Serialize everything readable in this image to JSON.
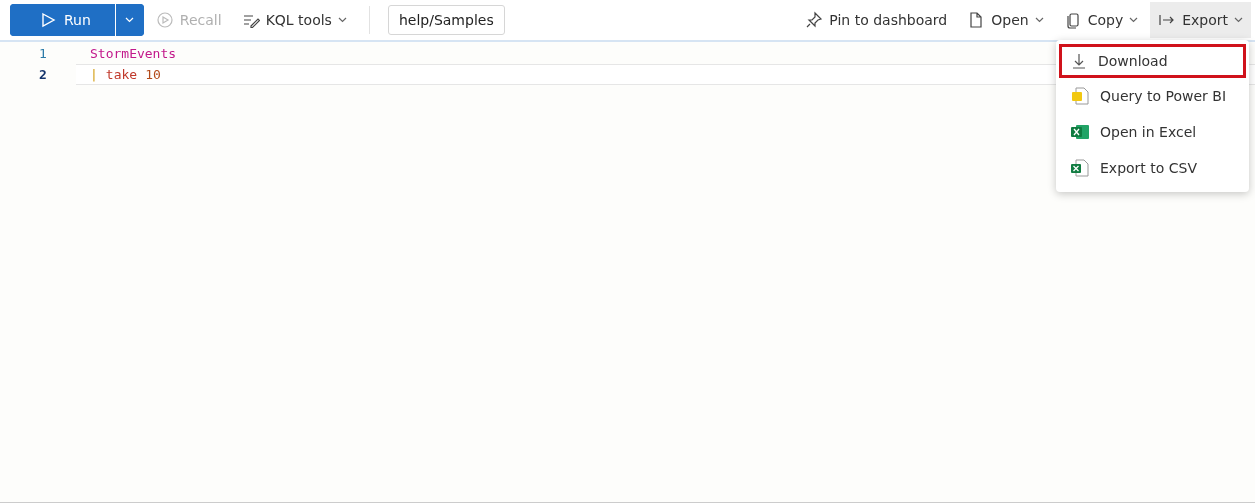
{
  "toolbar": {
    "run": {
      "label": "Run"
    },
    "left_items": [
      {
        "label": "Recall",
        "kind": "recall",
        "disabled": true,
        "has_caret": false
      },
      {
        "label": "KQL tools",
        "kind": "kql",
        "disabled": false,
        "has_caret": true
      }
    ],
    "database": "help/Samples",
    "right_items": [
      {
        "label": "Pin to dashboard",
        "kind": "pin",
        "has_caret": false,
        "expanded": false
      },
      {
        "label": "Open",
        "kind": "open",
        "has_caret": true,
        "expanded": false
      },
      {
        "label": "Copy",
        "kind": "copy",
        "has_caret": true,
        "expanded": false
      },
      {
        "label": "Export",
        "kind": "export",
        "has_caret": true,
        "expanded": true
      }
    ]
  },
  "editor": {
    "lines": [
      {
        "number": "1",
        "current": false,
        "tokens": [
          {
            "text": "StormEvents",
            "kind": "table"
          }
        ]
      },
      {
        "number": "2",
        "current": true,
        "tokens": [
          {
            "text": "|",
            "kind": "pipe"
          },
          {
            "text": "take",
            "kind": "keyword"
          },
          {
            "text": "10",
            "kind": "number"
          }
        ]
      }
    ]
  },
  "export_menu": {
    "items": [
      {
        "label": "Download",
        "kind": "download",
        "selected": true
      },
      {
        "label": "Query to Power BI",
        "kind": "powerbi",
        "selected": false
      },
      {
        "label": "Open in Excel",
        "kind": "excel",
        "selected": false
      },
      {
        "label": "Export to CSV",
        "kind": "csv",
        "selected": false
      }
    ]
  }
}
